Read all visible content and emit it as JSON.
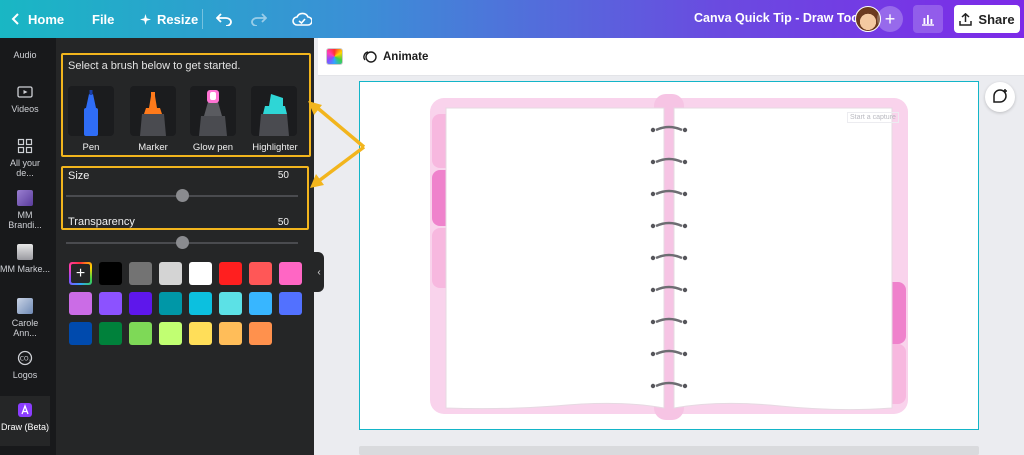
{
  "topbar": {
    "home_label": "Home",
    "file_label": "File",
    "resize_label": "Resize",
    "doc_title": "Canva Quick Tip - Draw Tool",
    "share_label": "Share",
    "gradient": [
      "#19b7c4",
      "#7d2ae8"
    ]
  },
  "rail": {
    "items": [
      {
        "label": "Audio",
        "icon": "audio-icon"
      },
      {
        "label": "Videos",
        "icon": "video-icon"
      },
      {
        "label": "All your de...",
        "icon": "grid-icon"
      },
      {
        "label": "MM Brandi...",
        "icon": "folder-thumb-icon"
      },
      {
        "label": "MM Marke...",
        "icon": "folder-thumb-icon"
      },
      {
        "label": "Carole Ann...",
        "icon": "folder-thumb-icon"
      },
      {
        "label": "Logos",
        "icon": "logo-icon"
      },
      {
        "label": "Draw (Beta)",
        "icon": "draw-icon"
      }
    ]
  },
  "panel": {
    "hint": "Select a brush below to get started.",
    "brushes": [
      {
        "label": "Pen",
        "color": "#2f6df6"
      },
      {
        "label": "Marker",
        "color": "#ff7a1a"
      },
      {
        "label": "Glow pen",
        "color": "#ff74d4"
      },
      {
        "label": "Highlighter",
        "color": "#2ed6d6"
      }
    ],
    "size_label": "Size",
    "size_value": "50",
    "transparency_label": "Transparency",
    "transparency_value": "50",
    "size_fraction": 0.5,
    "transparency_fraction": 0.5,
    "colors": [
      "#000000",
      "#737373",
      "#d4d4d4",
      "#ffffff",
      "#ff1f1f",
      "#ff5757",
      "#ff66c4",
      "#cb6ce6",
      "#8c52ff",
      "#5e17eb",
      "#0097a7",
      "#0cc0df",
      "#5ce1e6",
      "#38b6ff",
      "#5271ff",
      "#004aad",
      "#00813b",
      "#7ed957",
      "#c1ff72",
      "#ffde59",
      "#ffbd59",
      "#ff914d"
    ],
    "highlight_color": "#f2b51d"
  },
  "editor": {
    "animate_label": "Animate",
    "page_border": "#13b5c8",
    "capture_placeholder": "Start a capture"
  }
}
